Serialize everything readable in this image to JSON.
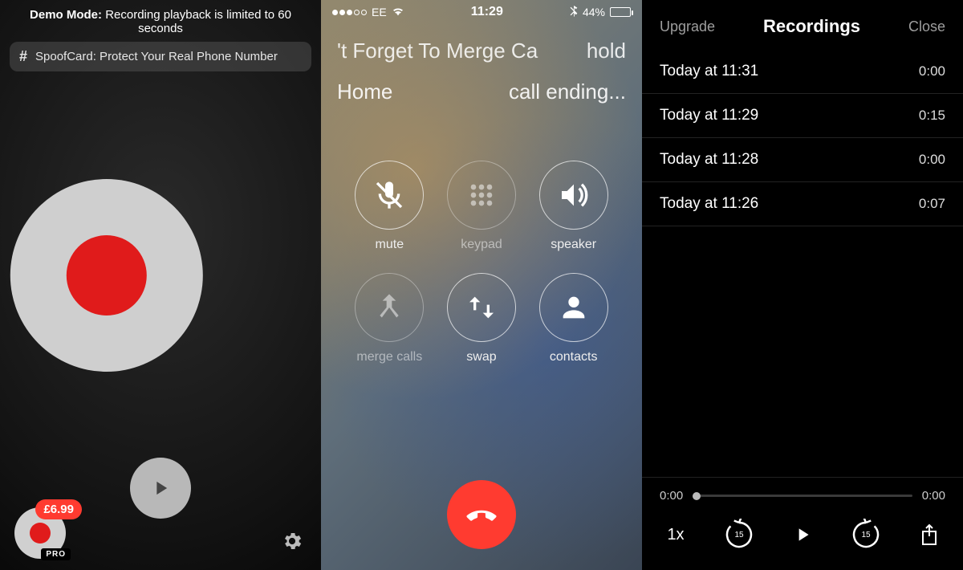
{
  "panel1": {
    "demo_label": "Demo Mode:",
    "demo_text": "Recording playback is limited to 60 seconds",
    "banner_text": "SpoofCard: Protect Your Real Phone Number",
    "price": "£6.99",
    "pro_label": "PRO"
  },
  "panel2": {
    "status": {
      "carrier": "EE",
      "time": "11:29",
      "battery_text": "44%",
      "battery_pct": 44
    },
    "line1": {
      "left": "'t Forget To Merge Ca",
      "right": "hold"
    },
    "line2": {
      "left": "Home",
      "right": "call ending..."
    },
    "buttons": {
      "mute": "mute",
      "keypad": "keypad",
      "speaker": "speaker",
      "merge": "merge calls",
      "swap": "swap",
      "contacts": "contacts"
    }
  },
  "panel3": {
    "header": {
      "left": "Upgrade",
      "title": "Recordings",
      "right": "Close"
    },
    "rows": [
      {
        "label": "Today at 11:31",
        "dur": "0:00"
      },
      {
        "label": "Today at 11:29",
        "dur": "0:15"
      },
      {
        "label": "Today at 11:28",
        "dur": "0:00"
      },
      {
        "label": "Today at 11:26",
        "dur": "0:07"
      }
    ],
    "player": {
      "current": "0:00",
      "total": "0:00",
      "speed": "1x",
      "skip_secs": "15"
    }
  }
}
